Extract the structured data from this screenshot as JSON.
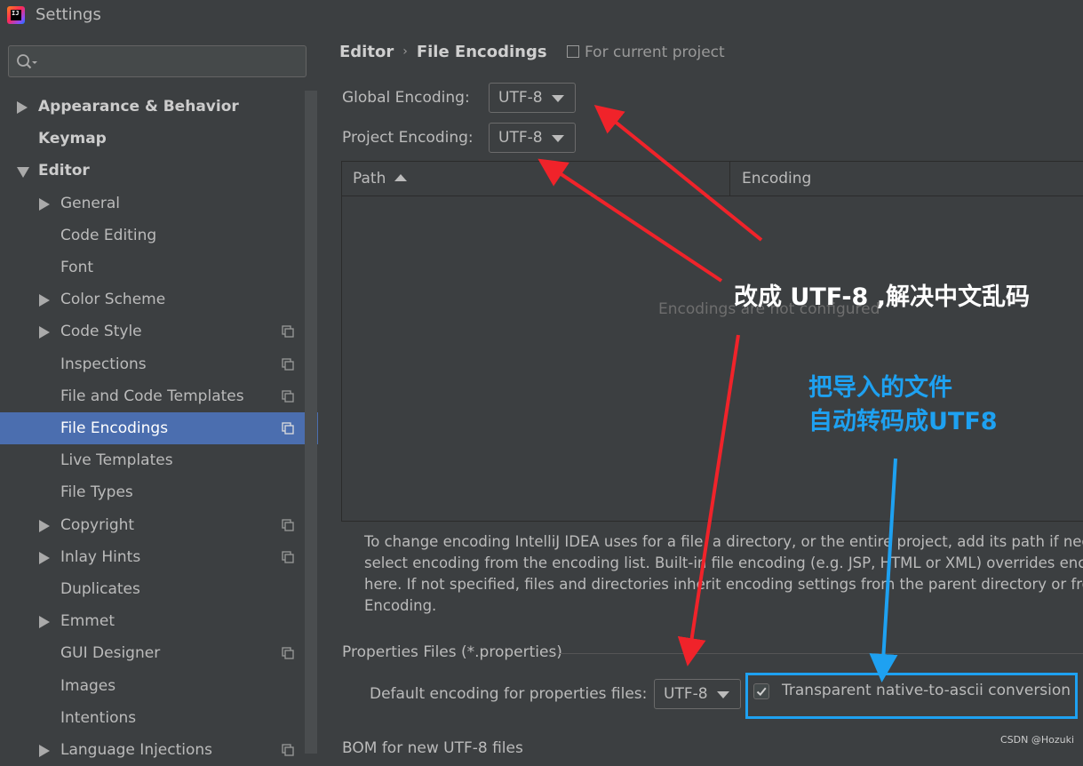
{
  "window": {
    "title": "Settings",
    "logo_text": "IJ"
  },
  "search": {
    "value": "",
    "placeholder": ""
  },
  "sidebar": {
    "items": [
      {
        "label": "Appearance & Behavior",
        "level": 0,
        "expand": "collapsed",
        "bold": true,
        "copy": false,
        "selected": false
      },
      {
        "label": "Keymap",
        "level": 0,
        "expand": "none",
        "bold": true,
        "copy": false,
        "selected": false
      },
      {
        "label": "Editor",
        "level": 0,
        "expand": "expanded",
        "bold": true,
        "copy": false,
        "selected": false
      },
      {
        "label": "General",
        "level": 1,
        "expand": "collapsed",
        "bold": false,
        "copy": false,
        "selected": false
      },
      {
        "label": "Code Editing",
        "level": 1,
        "expand": "none",
        "bold": false,
        "copy": false,
        "selected": false
      },
      {
        "label": "Font",
        "level": 1,
        "expand": "none",
        "bold": false,
        "copy": false,
        "selected": false
      },
      {
        "label": "Color Scheme",
        "level": 1,
        "expand": "collapsed",
        "bold": false,
        "copy": false,
        "selected": false
      },
      {
        "label": "Code Style",
        "level": 1,
        "expand": "collapsed",
        "bold": false,
        "copy": true,
        "selected": false
      },
      {
        "label": "Inspections",
        "level": 1,
        "expand": "none",
        "bold": false,
        "copy": true,
        "selected": false
      },
      {
        "label": "File and Code Templates",
        "level": 1,
        "expand": "none",
        "bold": false,
        "copy": true,
        "selected": false
      },
      {
        "label": "File Encodings",
        "level": 1,
        "expand": "none",
        "bold": false,
        "copy": true,
        "selected": true
      },
      {
        "label": "Live Templates",
        "level": 1,
        "expand": "none",
        "bold": false,
        "copy": false,
        "selected": false
      },
      {
        "label": "File Types",
        "level": 1,
        "expand": "none",
        "bold": false,
        "copy": false,
        "selected": false
      },
      {
        "label": "Copyright",
        "level": 1,
        "expand": "collapsed",
        "bold": false,
        "copy": true,
        "selected": false
      },
      {
        "label": "Inlay Hints",
        "level": 1,
        "expand": "collapsed",
        "bold": false,
        "copy": true,
        "selected": false
      },
      {
        "label": "Duplicates",
        "level": 1,
        "expand": "none",
        "bold": false,
        "copy": false,
        "selected": false
      },
      {
        "label": "Emmet",
        "level": 1,
        "expand": "collapsed",
        "bold": false,
        "copy": false,
        "selected": false
      },
      {
        "label": "GUI Designer",
        "level": 1,
        "expand": "none",
        "bold": false,
        "copy": true,
        "selected": false
      },
      {
        "label": "Images",
        "level": 1,
        "expand": "none",
        "bold": false,
        "copy": false,
        "selected": false
      },
      {
        "label": "Intentions",
        "level": 1,
        "expand": "none",
        "bold": false,
        "copy": false,
        "selected": false
      },
      {
        "label": "Language Injections",
        "level": 1,
        "expand": "collapsed",
        "bold": false,
        "copy": true,
        "selected": false
      }
    ]
  },
  "main": {
    "breadcrumb": {
      "parent": "Editor",
      "separator": "›",
      "current": "File Encodings"
    },
    "scope_label": "For current project",
    "global_encoding": {
      "label": "Global Encoding:",
      "value": "UTF-8"
    },
    "project_encoding": {
      "label": "Project Encoding:",
      "value": "UTF-8"
    },
    "table": {
      "columns": [
        "Path",
        "Encoding"
      ],
      "sort_column": "Path",
      "sort_direction": "ascending",
      "empty_text": "Encodings are not configured"
    },
    "description_lines": [
      "To change encoding IntelliJ IDEA uses for a file, a directory, or the entire project, add its path if nece",
      "select encoding from the encoding list. Built-in file encoding (e.g. JSP, HTML or XML) overrides enc",
      "here. If not specified, files and directories inherit encoding settings from the parent directory or fro",
      "Encoding."
    ],
    "properties_section": {
      "title": "Properties Files (*.properties)",
      "default_label": "Default encoding for properties files:",
      "default_value": "UTF-8",
      "native_to_ascii": {
        "label": "Transparent native-to-ascii conversion",
        "checked": true
      }
    },
    "bom_label": "BOM for new UTF-8 files"
  },
  "annotations": {
    "red_note": "改成 UTF-8 ,解决中文乱码",
    "blue_note_lines": [
      "把导入的文件",
      "自动转码成UTF8"
    ],
    "watermark": "CSDN @Hozuki",
    "colors": {
      "red": "#f0232a",
      "blue": "#1ea1f1"
    }
  },
  "colors": {
    "background": "#3c3f41",
    "selection": "#4b6eaf",
    "text": "#bbbbbb"
  }
}
